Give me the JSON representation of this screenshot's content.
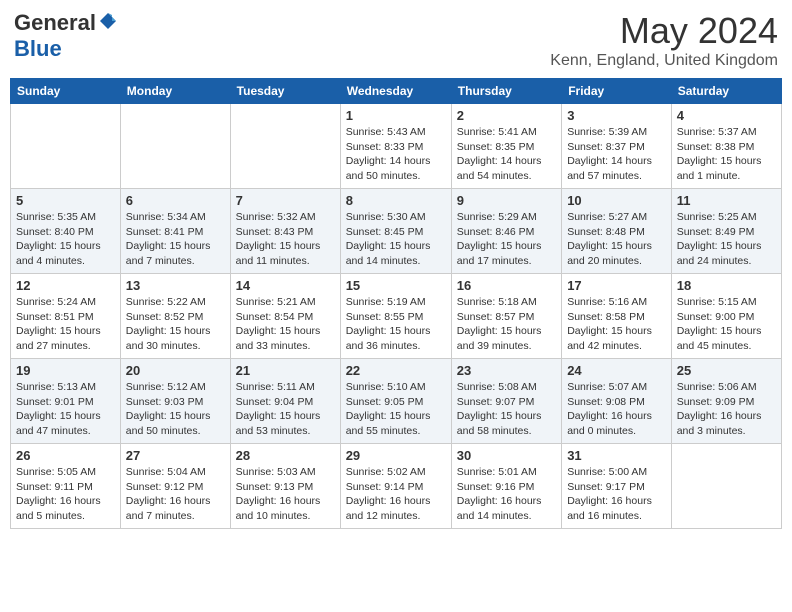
{
  "header": {
    "logo": {
      "general": "General",
      "blue": "Blue"
    },
    "title": "May 2024",
    "location": "Kenn, England, United Kingdom"
  },
  "days_of_week": [
    "Sunday",
    "Monday",
    "Tuesday",
    "Wednesday",
    "Thursday",
    "Friday",
    "Saturday"
  ],
  "weeks": [
    [
      {
        "day": "",
        "info": ""
      },
      {
        "day": "",
        "info": ""
      },
      {
        "day": "",
        "info": ""
      },
      {
        "day": "1",
        "info": "Sunrise: 5:43 AM\nSunset: 8:33 PM\nDaylight: 14 hours\nand 50 minutes."
      },
      {
        "day": "2",
        "info": "Sunrise: 5:41 AM\nSunset: 8:35 PM\nDaylight: 14 hours\nand 54 minutes."
      },
      {
        "day": "3",
        "info": "Sunrise: 5:39 AM\nSunset: 8:37 PM\nDaylight: 14 hours\nand 57 minutes."
      },
      {
        "day": "4",
        "info": "Sunrise: 5:37 AM\nSunset: 8:38 PM\nDaylight: 15 hours\nand 1 minute."
      }
    ],
    [
      {
        "day": "5",
        "info": "Sunrise: 5:35 AM\nSunset: 8:40 PM\nDaylight: 15 hours\nand 4 minutes."
      },
      {
        "day": "6",
        "info": "Sunrise: 5:34 AM\nSunset: 8:41 PM\nDaylight: 15 hours\nand 7 minutes."
      },
      {
        "day": "7",
        "info": "Sunrise: 5:32 AM\nSunset: 8:43 PM\nDaylight: 15 hours\nand 11 minutes."
      },
      {
        "day": "8",
        "info": "Sunrise: 5:30 AM\nSunset: 8:45 PM\nDaylight: 15 hours\nand 14 minutes."
      },
      {
        "day": "9",
        "info": "Sunrise: 5:29 AM\nSunset: 8:46 PM\nDaylight: 15 hours\nand 17 minutes."
      },
      {
        "day": "10",
        "info": "Sunrise: 5:27 AM\nSunset: 8:48 PM\nDaylight: 15 hours\nand 20 minutes."
      },
      {
        "day": "11",
        "info": "Sunrise: 5:25 AM\nSunset: 8:49 PM\nDaylight: 15 hours\nand 24 minutes."
      }
    ],
    [
      {
        "day": "12",
        "info": "Sunrise: 5:24 AM\nSunset: 8:51 PM\nDaylight: 15 hours\nand 27 minutes."
      },
      {
        "day": "13",
        "info": "Sunrise: 5:22 AM\nSunset: 8:52 PM\nDaylight: 15 hours\nand 30 minutes."
      },
      {
        "day": "14",
        "info": "Sunrise: 5:21 AM\nSunset: 8:54 PM\nDaylight: 15 hours\nand 33 minutes."
      },
      {
        "day": "15",
        "info": "Sunrise: 5:19 AM\nSunset: 8:55 PM\nDaylight: 15 hours\nand 36 minutes."
      },
      {
        "day": "16",
        "info": "Sunrise: 5:18 AM\nSunset: 8:57 PM\nDaylight: 15 hours\nand 39 minutes."
      },
      {
        "day": "17",
        "info": "Sunrise: 5:16 AM\nSunset: 8:58 PM\nDaylight: 15 hours\nand 42 minutes."
      },
      {
        "day": "18",
        "info": "Sunrise: 5:15 AM\nSunset: 9:00 PM\nDaylight: 15 hours\nand 45 minutes."
      }
    ],
    [
      {
        "day": "19",
        "info": "Sunrise: 5:13 AM\nSunset: 9:01 PM\nDaylight: 15 hours\nand 47 minutes."
      },
      {
        "day": "20",
        "info": "Sunrise: 5:12 AM\nSunset: 9:03 PM\nDaylight: 15 hours\nand 50 minutes."
      },
      {
        "day": "21",
        "info": "Sunrise: 5:11 AM\nSunset: 9:04 PM\nDaylight: 15 hours\nand 53 minutes."
      },
      {
        "day": "22",
        "info": "Sunrise: 5:10 AM\nSunset: 9:05 PM\nDaylight: 15 hours\nand 55 minutes."
      },
      {
        "day": "23",
        "info": "Sunrise: 5:08 AM\nSunset: 9:07 PM\nDaylight: 15 hours\nand 58 minutes."
      },
      {
        "day": "24",
        "info": "Sunrise: 5:07 AM\nSunset: 9:08 PM\nDaylight: 16 hours\nand 0 minutes."
      },
      {
        "day": "25",
        "info": "Sunrise: 5:06 AM\nSunset: 9:09 PM\nDaylight: 16 hours\nand 3 minutes."
      }
    ],
    [
      {
        "day": "26",
        "info": "Sunrise: 5:05 AM\nSunset: 9:11 PM\nDaylight: 16 hours\nand 5 minutes."
      },
      {
        "day": "27",
        "info": "Sunrise: 5:04 AM\nSunset: 9:12 PM\nDaylight: 16 hours\nand 7 minutes."
      },
      {
        "day": "28",
        "info": "Sunrise: 5:03 AM\nSunset: 9:13 PM\nDaylight: 16 hours\nand 10 minutes."
      },
      {
        "day": "29",
        "info": "Sunrise: 5:02 AM\nSunset: 9:14 PM\nDaylight: 16 hours\nand 12 minutes."
      },
      {
        "day": "30",
        "info": "Sunrise: 5:01 AM\nSunset: 9:16 PM\nDaylight: 16 hours\nand 14 minutes."
      },
      {
        "day": "31",
        "info": "Sunrise: 5:00 AM\nSunset: 9:17 PM\nDaylight: 16 hours\nand 16 minutes."
      },
      {
        "day": "",
        "info": ""
      }
    ]
  ]
}
